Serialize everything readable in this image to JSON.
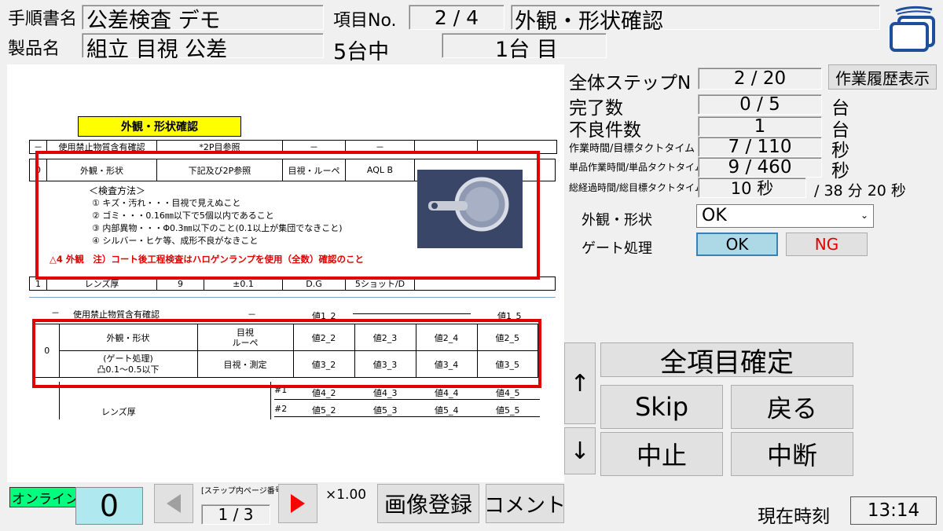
{
  "header": {
    "manual_label": "手順書名",
    "manual_value": "公差検査 デモ",
    "product_label": "製品名",
    "product_value": "組立 目視 公差",
    "item_no_label": "項目No.",
    "item_no_value": "2 / 4",
    "item_title": "外観・形状確認",
    "units_text": "5台中",
    "unit_index": "1台 目"
  },
  "document": {
    "title": "外観・形状確認",
    "top_row": [
      "－",
      "使用禁止物質含有確認",
      "*2P目参照",
      "－",
      "－"
    ],
    "main_row": [
      "0",
      "外観・形状",
      "下記及び2P参照",
      "目視・ルーペ",
      "AQL B"
    ],
    "method_title": "＜検査方法＞",
    "methods": [
      "① キズ・汚れ・・・目視で見えぬこと",
      "② ゴミ・・・0.16㎜以下で5個以内であること",
      "③ 内部異物・・・Φ0.3㎜以下のこと(0.1以上が集団でなきこと)",
      "④ シルバー・ヒケ等、成形不良がなきこと"
    ],
    "note": "△4 外観　注）コート後工程検査はハロゲンランプを使用（全数）確認のこと",
    "lens_row": [
      "1",
      "レンズ厚",
      "9",
      "±0.1",
      "D.G",
      "5ショット/D"
    ],
    "lower": {
      "row0": [
        "－",
        "使用禁止物質含有確認",
        "－",
        "値1_2",
        "値1_5"
      ],
      "item0": "0",
      "item_a_name": "外観・形状",
      "item_a_method": "目視\nルーペ",
      "item_a_vals": [
        "値2_2",
        "値2_3",
        "値2_4",
        "値2_5"
      ],
      "item_b_name": "(ゲート処理)\n凸0.1～0.5以下",
      "item_b_method": "目視・測定",
      "item_b_vals": [
        "値3_2",
        "値3_3",
        "値3_4",
        "値3_5"
      ],
      "lens_name": "レンズ厚",
      "lens1_tag": "#1",
      "lens1_vals": [
        "値4_2",
        "値4_3",
        "値4_4",
        "値4_5"
      ],
      "lens2_tag": "#2",
      "lens2_vals": [
        "値5_2",
        "値5_3",
        "値5_4",
        "値5_5"
      ]
    }
  },
  "side": {
    "total_step_label": "全体ステップN",
    "total_step_value": "2 / 20",
    "history_button": "作業履歴表示",
    "complete_label": "完了数",
    "complete_value": "0 / 5",
    "complete_unit": "台",
    "defect_label": "不良件数",
    "defect_value": "1",
    "defect_unit": "台",
    "work_time_label": "作業時間/目標タクトタイム",
    "work_time_value": "7 / 110",
    "work_time_unit": "秒",
    "unit_time_label": "単品作業時間/単品タクトタイム",
    "unit_time_value": "9 / 460",
    "unit_time_unit": "秒",
    "total_time_label": "総経過時間/総目標タクトタイム",
    "total_time_value": "10 秒",
    "total_time_target": "/ 38 分 20 秒",
    "appearance_label": "外観・形状",
    "appearance_select": "OK",
    "gate_label": "ゲート処理",
    "gate_ok": "OK",
    "gate_ng": "NG"
  },
  "actions": {
    "confirm_all": "全項目確定",
    "skip": "Skip",
    "back": "戻る",
    "stop": "中止",
    "suspend": "中断",
    "up_arrow": "↑",
    "down_arrow": "↓"
  },
  "footer": {
    "online_label": "オンライン",
    "counter": "0",
    "page_label": "[ステップ内ページ番号]",
    "page_value": "1 / 3",
    "zoom": "×1.00",
    "image_register": "画像登録",
    "comment": "コメント",
    "clock_label": "現在時刻",
    "clock_value": "13:14"
  },
  "colors": {
    "red_frame": "#e00000",
    "doc_title_bg": "#ffff00",
    "ok_active_bg": "#add8e6",
    "online_bg": "#00ff7f",
    "counter_bg": "#b0e8f0",
    "nav_next": "#ff0000"
  },
  "icons": {
    "app_icon": "window-stack-icon",
    "prev": "prev-triangle-icon",
    "next": "next-triangle-icon"
  }
}
